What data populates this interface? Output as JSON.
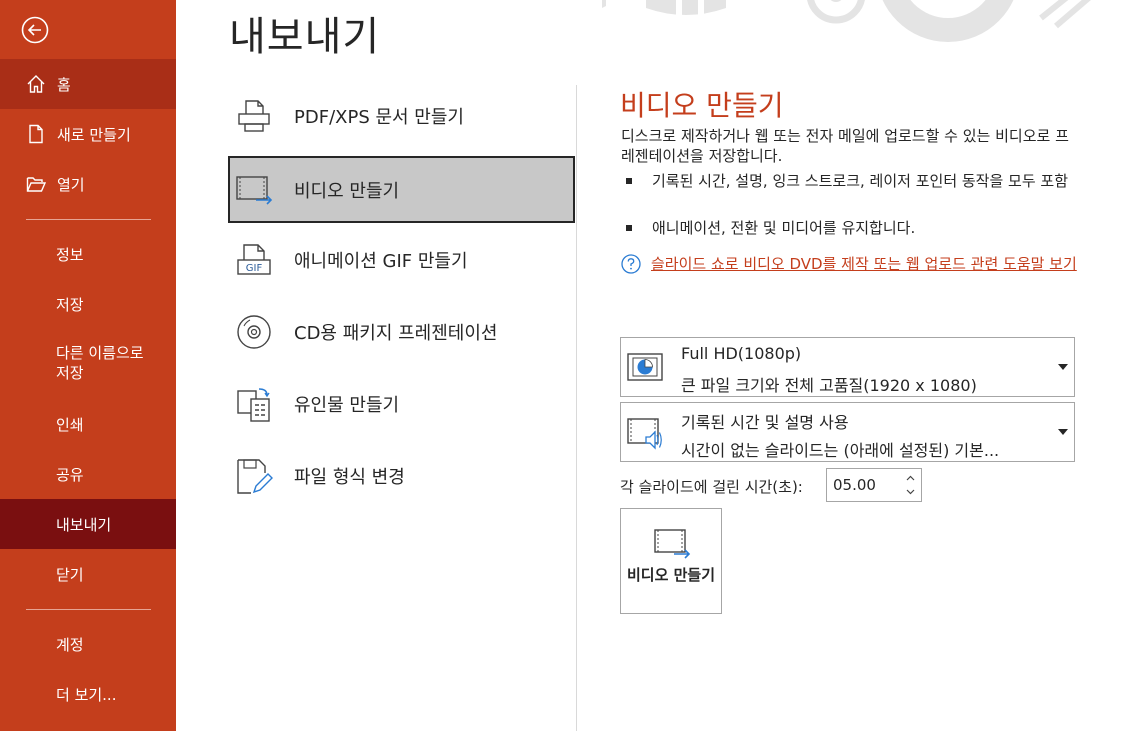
{
  "sidebar": {
    "items": [
      {
        "label": "홈"
      },
      {
        "label": "새로 만들기"
      },
      {
        "label": "열기"
      },
      {
        "label": "정보"
      },
      {
        "label": "저장"
      },
      {
        "label": "다른 이름으로 저장"
      },
      {
        "label": "인쇄"
      },
      {
        "label": "공유"
      },
      {
        "label": "내보내기"
      },
      {
        "label": "닫기"
      },
      {
        "label": "계정"
      },
      {
        "label": "더 보기..."
      }
    ],
    "active": "내보내기",
    "bg_color": "#c43e1c",
    "active_color": "#7a0f10"
  },
  "page": {
    "title": "내보내기"
  },
  "options": [
    {
      "label": "PDF/XPS 문서 만들기",
      "icon": "printer-pdf-icon"
    },
    {
      "label": "비디오 만들기",
      "icon": "video-export-icon",
      "selected": true
    },
    {
      "label": "애니메이션 GIF 만들기",
      "icon": "gif-icon"
    },
    {
      "label": "CD용 패키지 프레젠테이션",
      "icon": "cd-icon"
    },
    {
      "label": "유인물 만들기",
      "icon": "handout-icon"
    },
    {
      "label": "파일 형식 변경",
      "icon": "file-edit-icon"
    }
  ],
  "detail": {
    "title": "비디오 만들기",
    "description": "디스크로 제작하거나 웹 또는 전자 메일에 업로드할 수 있는 비디오로 프레젠테이션을 저장합니다.",
    "bullets": [
      "기록된 시간, 설명, 잉크 스트로크, 레이저 포인터 동작을 모두 포함",
      "애니메이션, 전환 및 미디어를 유지합니다."
    ],
    "help_link": "슬라이드 쇼로 비디오 DVD를 제작 또는 웹 업로드 관련 도움말 보기",
    "quality": {
      "title": "Full HD(1080p)",
      "subtitle": "큰 파일 크기와 전체 고품질(1920 x 1080)"
    },
    "narration": {
      "title": "기록된 시간 및 설명 사용",
      "subtitle": "시간이 없는 슬라이드는 (아래에 설정된) 기본..."
    },
    "duration_label": "각 슬라이드에 걸린 시간(초):",
    "duration_value": "05.00",
    "create_button": "비디오 만들기",
    "accent_color": "#c43e1c"
  }
}
